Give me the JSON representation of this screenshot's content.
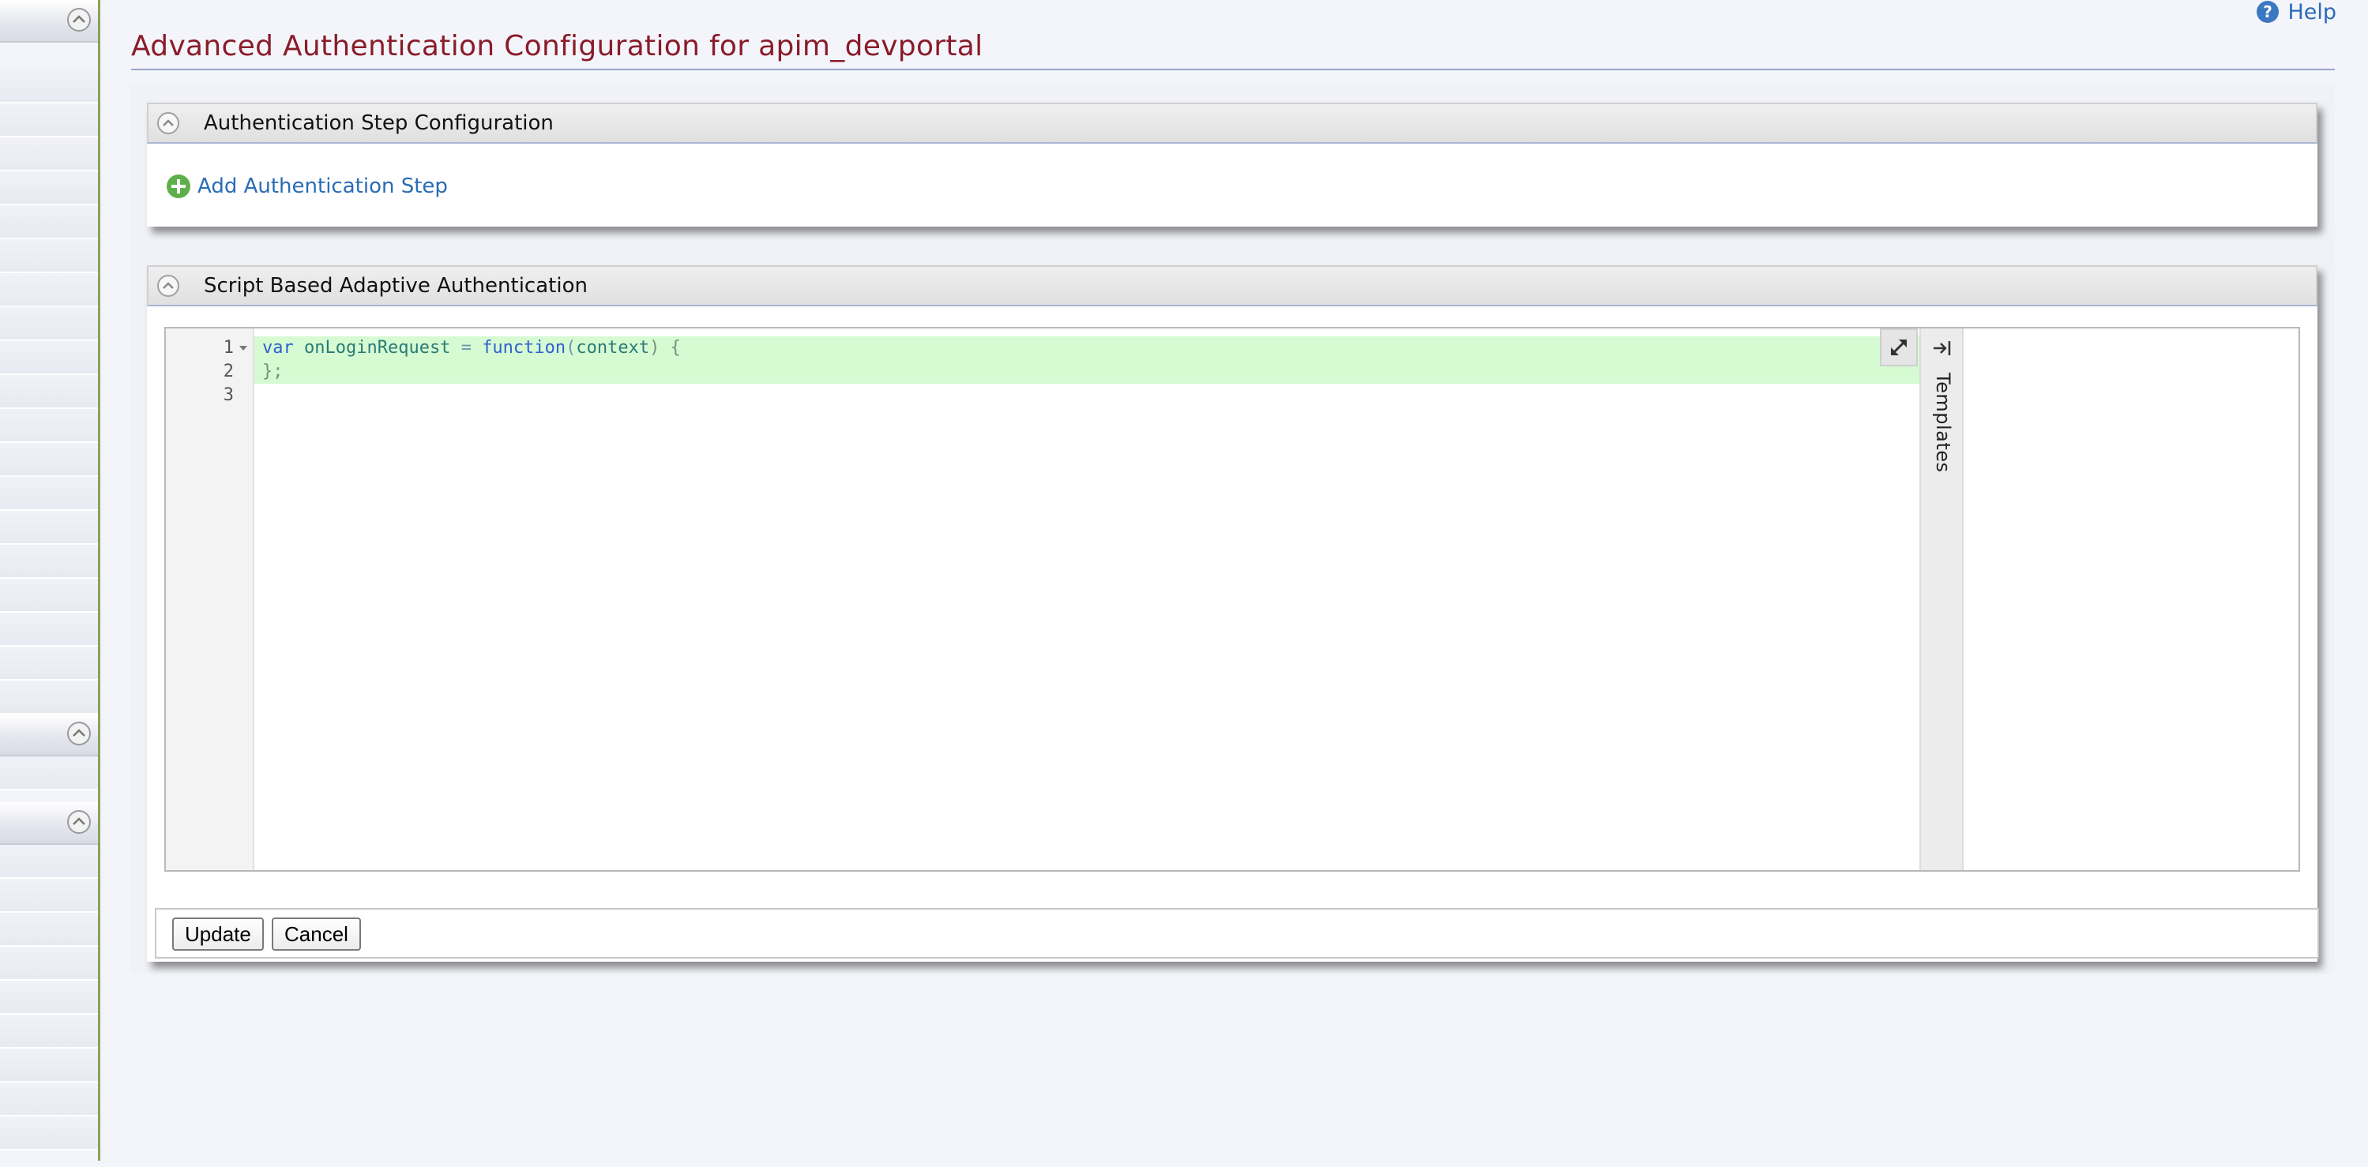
{
  "header": {
    "help_label": "Help",
    "page_title": "Advanced Authentication Configuration for apim_devportal"
  },
  "sections": {
    "steps": {
      "title": "Authentication Step Configuration",
      "add_step_label": "Add Authentication Step"
    },
    "script": {
      "title": "Script Based Adaptive Authentication",
      "templates_label": "Templates",
      "line_numbers": [
        "1",
        "2",
        "3"
      ],
      "code": {
        "line1": {
          "kw_var": "var",
          "name": "onLoginRequest",
          "op": "=",
          "kw_function": "function",
          "open_paren": "(",
          "param": "context",
          "close": ") {"
        },
        "line2": "};"
      }
    }
  },
  "actions": {
    "update_label": "Update",
    "cancel_label": "Cancel"
  },
  "colors": {
    "title": "#8a1c2b",
    "link": "#2a6cb6",
    "highlight": "#d6fbd2",
    "sidebar_border": "#8aa25a"
  },
  "icons": {
    "help": "question-circle-icon",
    "section_toggle": "chevron-up-circle-icon",
    "add": "plus-circle-icon",
    "expand": "expand-arrows-icon",
    "templates_pin": "arrow-to-right-icon",
    "fold": "triangle-down-icon"
  }
}
